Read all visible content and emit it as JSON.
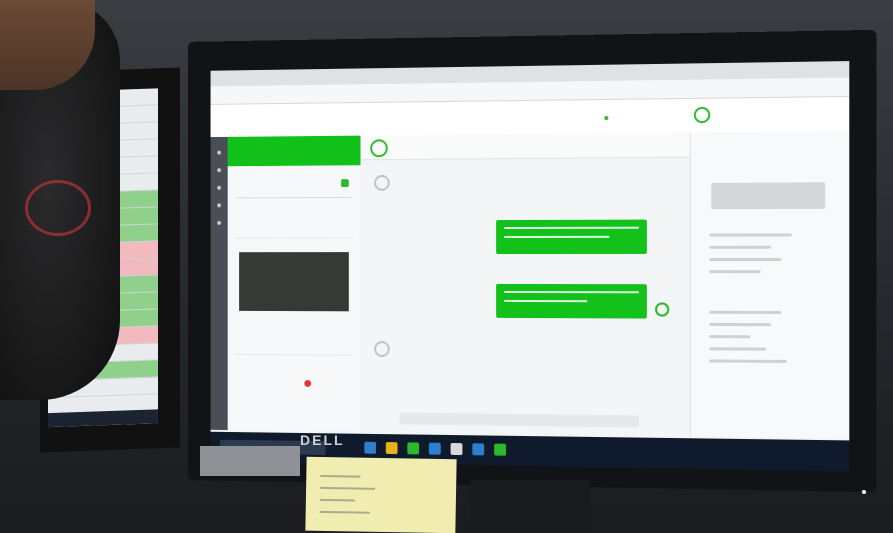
{
  "scene": {
    "brand_on_monitor": "DELL",
    "left_monitor_rows": [
      "plain",
      "plain",
      "plain",
      "plain",
      "plain",
      "plain",
      "green",
      "green",
      "green",
      "pink",
      "pink",
      "green",
      "green",
      "green",
      "pink",
      "plain",
      "green",
      "plain",
      "plain"
    ],
    "colors": {
      "accent_green": "#11c11a",
      "alert_red": "#e2323a",
      "highlight_orange": "#ff8a1c",
      "taskbar_navy": "#0f1b2c",
      "sticky_note_yellow": "#f1edb1"
    }
  },
  "app": {
    "nav_dots": [
      "dot",
      "dot",
      "dot",
      "dot",
      "dot"
    ],
    "conversation_list": [
      "item",
      "item",
      "item"
    ],
    "chat_bubbles": 2,
    "taskbar_icons": [
      "#2f7fd1",
      "#e6b31e",
      "#2eb82b",
      "#2f7fd1",
      "#d9d9d9",
      "#2f7fd1",
      "#2eb82b"
    ]
  }
}
